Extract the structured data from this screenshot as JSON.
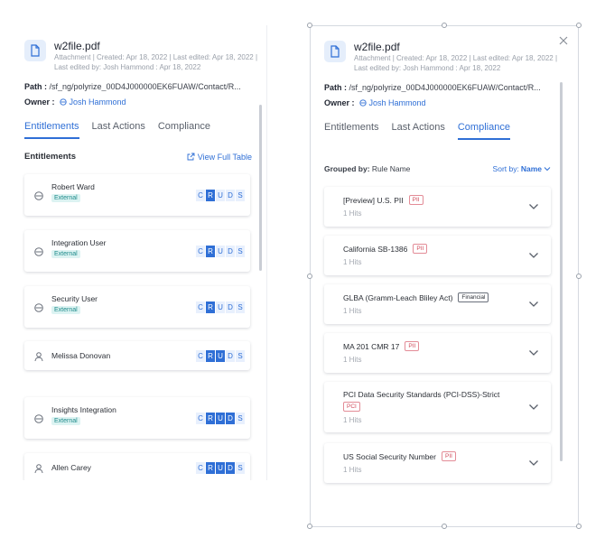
{
  "file": {
    "name": "w2file.pdf",
    "meta": "Attachment | Created: Apr 18, 2022 | Last edited: Apr 18, 2022 | Last edited by: Josh Hammond : Apr 18, 2022",
    "path_label": "Path :",
    "path_value": " /sf_ng/polyrize_00D4J000000EK6FUAW/Contact/R...",
    "owner_label": "Owner :",
    "owner_name": "Josh Hammond"
  },
  "tabs": [
    "Entitlements",
    "Last Actions",
    "Compliance"
  ],
  "left": {
    "section_title": "Entitlements",
    "view_full": "View Full Table",
    "entitlements": [
      {
        "name": "Robert Ward",
        "badge": "External",
        "icon": "group-icon",
        "crud": [
          0,
          1,
          0,
          0,
          0
        ]
      },
      {
        "name": "Integration User",
        "badge": "External",
        "icon": "group-icon",
        "crud": [
          0,
          1,
          0,
          0,
          0
        ]
      },
      {
        "name": "Security User",
        "badge": "External",
        "icon": "group-icon",
        "crud": [
          0,
          1,
          0,
          0,
          0
        ]
      },
      {
        "name": "Melissa Donovan",
        "badge": "",
        "icon": "person-icon",
        "crud": [
          0,
          1,
          1,
          0,
          0
        ]
      },
      {
        "name": "Insights Integration",
        "badge": "External",
        "icon": "group-icon",
        "crud": [
          0,
          1,
          1,
          1,
          0
        ]
      },
      {
        "name": "Allen Carey",
        "badge": "",
        "icon": "person-icon",
        "crud": [
          0,
          1,
          1,
          1,
          0
        ]
      }
    ],
    "crud_letters": [
      "C",
      "R",
      "U",
      "D",
      "S"
    ]
  },
  "right": {
    "grouped_label": "Grouped by:",
    "grouped_value": " Rule Name",
    "sort_label": "Sort by:",
    "sort_value": "Name",
    "rules": [
      {
        "title": "[Preview] U.S. PII",
        "tag": "PII",
        "tag_type": "pii",
        "hits": "1 Hits"
      },
      {
        "title": "California SB-1386",
        "tag": "PII",
        "tag_type": "pii",
        "hits": "1 Hits"
      },
      {
        "title": "GLBA (Gramm-Leach Bliley Act)",
        "tag": "Financial",
        "tag_type": "fin",
        "hits": "1 Hits"
      },
      {
        "title": "MA 201 CMR 17",
        "tag": "PII",
        "tag_type": "pii",
        "hits": "1 Hits"
      },
      {
        "title": "PCI Data Security Standards (PCI-DSS)-Strict",
        "tag": "PCI",
        "tag_type": "pii",
        "hits": "1 Hits"
      },
      {
        "title": "US Social Security Number",
        "tag": "PII",
        "tag_type": "pii",
        "hits": "1 Hits"
      }
    ]
  },
  "colors": {
    "accent": "#2f6fd6",
    "badge_bg": "#dcf3f2",
    "pii": "#d04a5a"
  }
}
